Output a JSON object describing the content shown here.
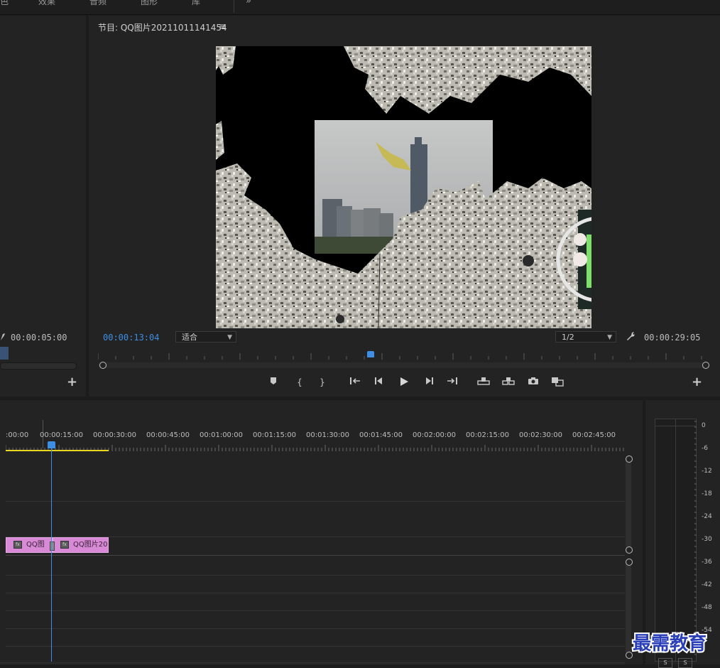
{
  "topbar": {
    "workspaces": [
      "色",
      "效果",
      "音频",
      "图形",
      "库"
    ],
    "more_label": "»"
  },
  "source_panel": {
    "timecode": "00:00:05:00",
    "add_label": "+"
  },
  "program_monitor": {
    "title": "节目: QQ图片20211011141454",
    "menu_label": "≡",
    "current_timecode": "00:00:13:04",
    "zoom_value": "适合",
    "resolution_value": "1/2",
    "duration_timecode": "00:00:29:05",
    "add_label": "+"
  },
  "transport": {
    "buttons": [
      "marker-icon",
      "mark-in-icon",
      "mark-out-icon",
      "go-to-in-icon",
      "step-back-icon",
      "play-icon",
      "step-forward-icon",
      "go-to-out-icon",
      "lift-icon",
      "extract-icon",
      "export-frame-icon",
      "compare-icon"
    ]
  },
  "timeline": {
    "ruler_labels": [
      ":00:00",
      "00:00:15:00",
      "00:00:30:00",
      "00:00:45:00",
      "00:01:00:00",
      "00:01:15:00",
      "00:01:30:00",
      "00:01:45:00",
      "00:02:00:00",
      "00:02:15:00",
      "00:02:30:00",
      "00:02:45:00"
    ],
    "clips": [
      {
        "label": "QQ图"
      },
      {
        "label": "QQ图片20"
      }
    ]
  },
  "audio_meter": {
    "scale": [
      "0",
      "-6",
      "-12",
      "-18",
      "-24",
      "-30",
      "-36",
      "-42",
      "-48",
      "-54"
    ],
    "solo_labels": [
      "S",
      "S"
    ]
  },
  "watermark": {
    "text": "最需教育"
  },
  "colors": {
    "accent_blue": "#3e8ee6",
    "clip_pink": "#d98ad6",
    "work_area_yellow": "#e8d620",
    "panel_bg": "#232323"
  }
}
